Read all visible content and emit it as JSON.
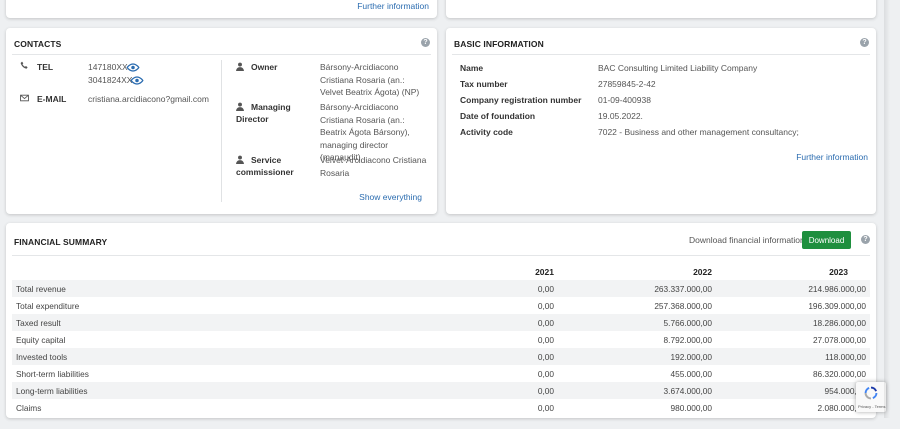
{
  "top_left_card": {
    "link": "Further information"
  },
  "contacts": {
    "title": "CONTACTS",
    "tel_label": "TEL",
    "tel_values": [
      "147180XX",
      "3041824XX"
    ],
    "email_label": "E-MAIL",
    "email_value": "cristiana.arcidiacono?gmail.com",
    "owner_label": "Owner",
    "owner_value": "Bársony-Arcidiacono Cristiana Rosaria (an.: Velvet Beatrix Ágota) (NP)",
    "md_label_1": "Managing",
    "md_label_2": "Director",
    "md_value": "Bársony-Arcidiacono Cristiana Rosaria (an.: Beatrix Ágota Bársony), managing director (manaudit)",
    "sc_label_1": "Service",
    "sc_label_2": "commissioner",
    "sc_value": "Velvet-Arcidiacono Cristiana Rosaria",
    "show_everything": "Show everything"
  },
  "basic_info": {
    "title": "BASIC INFORMATION",
    "rows": [
      {
        "label": "Name",
        "value": "BAC Consulting Limited Liability Company"
      },
      {
        "label": "Tax number",
        "value": "27859845-2-42"
      },
      {
        "label": "Company registration number",
        "value": "01-09-400938"
      },
      {
        "label": "Date of foundation",
        "value": "19.05.2022."
      },
      {
        "label": "Activity code",
        "value": "7022 - Business and other management consultancy;"
      }
    ],
    "link": "Further information"
  },
  "financial": {
    "title": "FINANCIAL SUMMARY",
    "download_text": "Download financial information",
    "download_button": "Download",
    "years": [
      "2021",
      "2022",
      "2023"
    ],
    "rows": [
      {
        "label": "Total revenue",
        "v2021": "0,00",
        "v2022": "263.337.000,00",
        "v2023": "214.986.000,00"
      },
      {
        "label": "Total expenditure",
        "v2021": "0,00",
        "v2022": "257.368.000,00",
        "v2023": "196.309.000,00"
      },
      {
        "label": "Taxed result",
        "v2021": "0,00",
        "v2022": "5.766.000,00",
        "v2023": "18.286.000,00"
      },
      {
        "label": "Equity capital",
        "v2021": "0,00",
        "v2022": "8.792.000,00",
        "v2023": "27.078.000,00"
      },
      {
        "label": "Invested tools",
        "v2021": "0,00",
        "v2022": "192.000,00",
        "v2023": "118.000,00"
      },
      {
        "label": "Short-term liabilities",
        "v2021": "0,00",
        "v2022": "455.000,00",
        "v2023": "86.320.000,00"
      },
      {
        "label": "Long-term liabilities",
        "v2021": "0,00",
        "v2022": "3.674.000,00",
        "v2023": "954.000,00"
      },
      {
        "label": "Claims",
        "v2021": "0,00",
        "v2022": "980.000,00",
        "v2023": "2.080.000,00"
      }
    ]
  },
  "recaptcha": {
    "footer": "Privacy - Terms"
  },
  "colors": {
    "accent": "#2b6cb0",
    "download": "#1e8f3e"
  }
}
